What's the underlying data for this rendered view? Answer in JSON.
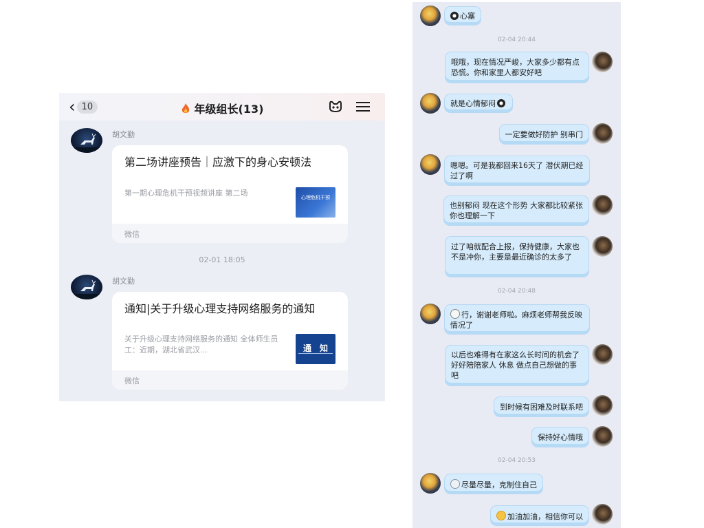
{
  "group_chat": {
    "header": {
      "unread_count": "10",
      "title": "年级组长(13)"
    },
    "messages": [
      {
        "sender": "胡文勤",
        "card_title": "第二场讲座预告｜应激下的身心安顿法",
        "card_desc": "第一期心理危机干预视频讲座 第二场",
        "thumb_text": "心理危机干预",
        "source": "微信"
      },
      {
        "sender": "胡文勤",
        "card_title": "通知|关于升级心理支持网络服务的通知",
        "card_desc": "关于升级心理支持网络服务的通知 全体师生员工：近期，湖北省武汉...",
        "thumb_text": "通　知",
        "source": "微信"
      }
    ],
    "timestamp": "02-01 18:05"
  },
  "private_chat": {
    "items": [
      {
        "kind": "msg",
        "side": "other",
        "text": "心塞"
      },
      {
        "kind": "time",
        "text": "02-04 20:44"
      },
      {
        "kind": "msg",
        "side": "me",
        "text": "哦哦，现在情况严峻，大家多少都有点恐慌。你和家里人都安好吧"
      },
      {
        "kind": "msg",
        "side": "other",
        "text": "就是心情郁闷"
      },
      {
        "kind": "msg",
        "side": "me",
        "text": "一定要做好防护 别串门"
      },
      {
        "kind": "msg",
        "side": "other",
        "text": "嗯嗯。可是我都回来16天了 潜伏期已经过了啊"
      },
      {
        "kind": "msg",
        "side": "me",
        "text": "也别郁闷 现在这个形势 大家都比较紧张 你也理解一下"
      },
      {
        "kind": "msg",
        "side": "me",
        "text": "过了咱就配合上报，保持健康，大家也不是冲你，主要是最近确诊的太多了"
      },
      {
        "kind": "time",
        "text": "02-04 20:48"
      },
      {
        "kind": "msg",
        "side": "other",
        "text": "行，谢谢老师啦。麻烦老师帮我反映情况了"
      },
      {
        "kind": "msg",
        "side": "me",
        "text": "以后也难得有在家这么长时间的机会了 好好陪陪家人 休息 做点自己想做的事吧"
      },
      {
        "kind": "msg",
        "side": "me",
        "text": "到时候有困难及时联系吧"
      },
      {
        "kind": "msg",
        "side": "me",
        "text": "保持好心情哦"
      },
      {
        "kind": "time",
        "text": "02-04 20:53"
      },
      {
        "kind": "msg",
        "side": "other",
        "text": "尽量尽量，克制住自己"
      },
      {
        "kind": "msg",
        "side": "me",
        "text": "加油加油，相信你可以"
      }
    ]
  },
  "icons": {
    "back": "chevron-left-icon",
    "fire": "fire-icon",
    "robot": "robot-icon",
    "menu": "menu-icon",
    "qq_penguin": "qq-penguin-emoji-icon",
    "laugh": "laugh-emoji-icon",
    "face": "face-emoji-icon",
    "ghost": "ghost-emoji-icon",
    "sun": "sun-emoji-icon"
  },
  "colors": {
    "bubble": "#d6ecfc",
    "bubble_border": "#b7d8f3",
    "panel_bg": "#e9ebf4"
  }
}
